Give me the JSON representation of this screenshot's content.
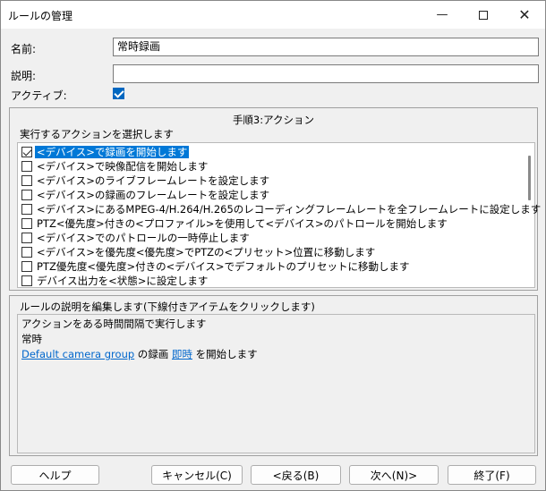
{
  "window": {
    "title": "ルールの管理"
  },
  "form": {
    "name_label": "名前:",
    "name_value": "常時録画",
    "desc_label": "説明:",
    "desc_value": "",
    "active_label": "アクティブ:",
    "active_checked": true
  },
  "actions_panel": {
    "step_title": "手順3:アクション",
    "prompt": "実行するアクションを選択します",
    "items": [
      {
        "label": "<デバイス>で録画を開始します",
        "checked": true,
        "selected": true
      },
      {
        "label": "<デバイス>で映像配信を開始します",
        "checked": false,
        "selected": false
      },
      {
        "label": "<デバイス>のライブフレームレートを設定します",
        "checked": false,
        "selected": false
      },
      {
        "label": "<デバイス>の録画のフレームレートを設定します",
        "checked": false,
        "selected": false
      },
      {
        "label": "<デバイス>にあるMPEG-4/H.264/H.265のレコーディングフレームレートを全フレームレートに設定します",
        "checked": false,
        "selected": false
      },
      {
        "label": "PTZ<優先度>付きの<プロファイル>を使用して<デバイス>のパトロールを開始します",
        "checked": false,
        "selected": false
      },
      {
        "label": "<デバイス>でのパトロールの一時停止します",
        "checked": false,
        "selected": false
      },
      {
        "label": "<デバイス>を優先度<優先度>でPTZの<プリセット>位置に移動します",
        "checked": false,
        "selected": false
      },
      {
        "label": "PTZ優先度<優先度>付きの<デバイス>でデフォルトのプリセットに移動します",
        "checked": false,
        "selected": false
      },
      {
        "label": "デバイス出力を<状態>に設定します",
        "checked": false,
        "selected": false
      }
    ]
  },
  "description_panel": {
    "header": "ルールの説明を編集します(下線付きアイテムをクリックします)",
    "line1": "アクションをある時間間隔で実行します",
    "line2": "常時",
    "line3": {
      "link1": "Default camera group",
      "text1": " の録画 ",
      "link2": "即時",
      "text2": " を開始します"
    }
  },
  "buttons": {
    "help": "ヘルプ",
    "cancel": "キャンセル(C)",
    "back": "<戻る(B)",
    "next": "次へ(N)>",
    "finish": "終了(F)"
  }
}
